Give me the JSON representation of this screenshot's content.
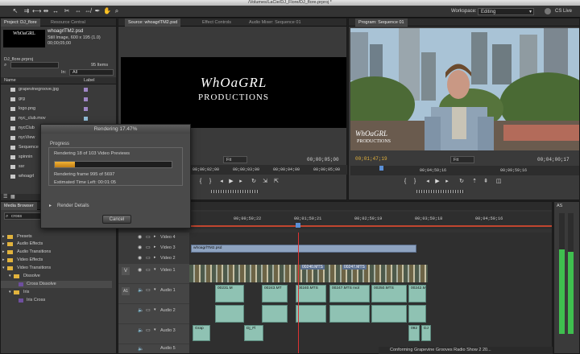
{
  "window": {
    "title": "/Volumes/LaCie/DJ_Flore/DJ_flore.prproj *"
  },
  "toolbar": {
    "workspace_label": "Workspace:",
    "workspace_value": "Editing",
    "cs_live": "CS Live"
  },
  "project_panel": {
    "tabs": [
      "Project: DJ_flore",
      "Resource Central"
    ],
    "preview_name": "whoagrlTM2.psd",
    "preview_info_1": "Still Image, 600 x 195 (1.0)",
    "preview_info_2": "00;00;05;00",
    "project_file": "DJ_flore.prproj",
    "items_count": "95 Items",
    "in_label": "In:",
    "in_value": "All",
    "col_name": "Name",
    "col_label": "Label",
    "items": [
      "grapevinegroove.jpg",
      "grg",
      "logo.png",
      "nyc_club.mov",
      "nycClub",
      "nycView",
      "Sequence",
      "spinnin",
      "ssr",
      "whoagrl"
    ]
  },
  "source_panel": {
    "tabs": [
      "Source: whoagrlTM2.psd",
      "Effect Controls",
      "Audio Mixer: Sequence 01"
    ],
    "title_line1": "WhOaGRL",
    "title_line2": "PRODUCTIONS",
    "fit": "Fit",
    "tc_right": "00;00;05;00",
    "ruler": [
      "00;00;02;00",
      "00;00;03;00",
      "00;00;04;00",
      "00;00;05;00"
    ]
  },
  "program_panel": {
    "tab": "Program: Sequence 01",
    "overlay_1": "WhOaGRL",
    "overlay_2": "PRODUCTIONS",
    "tc_current": "00;01;47;19",
    "fit": "Fit",
    "tc_duration": "00;04;00;17",
    "ruler": [
      "00;04;59;16",
      "00;09;59;16"
    ]
  },
  "render_dialog": {
    "title": "Rendering",
    "percent": "17.47%",
    "progress_label": "Progress",
    "status_line": "Rendering 18 of 103 Video Previews",
    "progress_value": 0.17,
    "frame_line": "Rendering frame 995 of 5697",
    "time_left": "Estimated Time Left: 00:01:05",
    "details": "Render Details",
    "cancel": "Cancel"
  },
  "effects_panel": {
    "tab": "Media Browser",
    "search": "cross",
    "items": [
      "Presets",
      "Audio Effects",
      "Audio Transitions",
      "Video Effects",
      "Video Transitions",
      "Dissolve",
      "Cross Dissolve",
      "Iris",
      "Iris Cross"
    ]
  },
  "timeline": {
    "ruler": [
      "00;00;59;22",
      "00;01;59;21",
      "00;02;59;19",
      "00;03;59;18",
      "00;04;59;16"
    ],
    "tracks": [
      "Video 4",
      "Video 3",
      "Video 2",
      "Video 1",
      "Audio 1",
      "Audio 2",
      "Audio 3",
      "Audio 5"
    ],
    "v_label": "V",
    "a_label": "A1",
    "clip_v3": "whoagrlTM2.psd",
    "clip_v1": [
      "00240.MTS",
      "00247.MTS"
    ],
    "a1_clips": [
      "00231.M",
      "00243.MT",
      "00240.MTS",
      "00247.MTS rvol",
      "00250.MTS",
      "00242.MTS rvol"
    ],
    "a3_clips": [
      "Grap",
      "Dj_Fl",
      "092",
      "DJ"
    ]
  },
  "statusbar": {
    "text": "Conforming Grapevine Grooves Radio Show 2 20..."
  },
  "audio_meter": {
    "label": "AS"
  }
}
